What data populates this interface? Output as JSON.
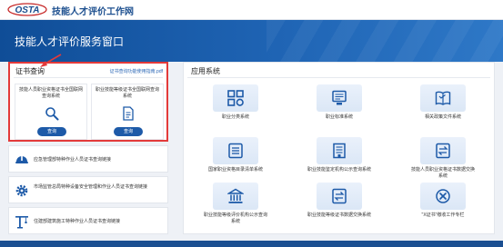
{
  "header": {
    "logo_text": "OSTA",
    "site_title": "技能人才评价工作网"
  },
  "banner": {
    "title": "技能人才评价服务窗口"
  },
  "cert_query": {
    "heading": "证书查询",
    "guide_link": "证书查询功能使用指南.pdf",
    "cards": [
      {
        "title": "技能人员职业资格证书全国联网查询系统",
        "button": "查询",
        "icon": "magnifier-icon"
      },
      {
        "title": "职业技能等级证书全国联网查询系统",
        "button": "查询",
        "icon": "document-icon"
      }
    ]
  },
  "services": [
    {
      "label": "应急管理部特种作业人员证书查询链接",
      "icon": "worker-helmet-icon"
    },
    {
      "label": "市场监管总局特种设备安全管理和作业人员证书查询链接",
      "icon": "gear-icon"
    },
    {
      "label": "住建部建筑施工特种作业人员证书查询链接",
      "icon": "crane-icon"
    }
  ],
  "apps": {
    "heading": "应用系统",
    "items": [
      {
        "label": "职业分类系统",
        "icon": "grid-icon"
      },
      {
        "label": "职业标准系统",
        "icon": "monitor-icon"
      },
      {
        "label": "相关政策文件系统",
        "icon": "book-icon"
      },
      {
        "label": "国家职业资格目录清单系统",
        "icon": "list-icon"
      },
      {
        "label": "职业技能鉴定机构公示查询系统",
        "icon": "building-icon"
      },
      {
        "label": "技能人员职业资格证书数据交换系统",
        "icon": "exchange-icon"
      },
      {
        "label": "职业技能等级评价机构公示查询系统",
        "icon": "institution-icon"
      },
      {
        "label": "职业技能等级证书数据交换系统",
        "icon": "exchange-icon"
      },
      {
        "label": "\"X证书\"缴收工作专栏",
        "icon": "x-cert-icon"
      }
    ]
  },
  "colors": {
    "brand": "#1c4f8f",
    "button": "#1d5aa8",
    "highlight": "#e33a3a"
  }
}
